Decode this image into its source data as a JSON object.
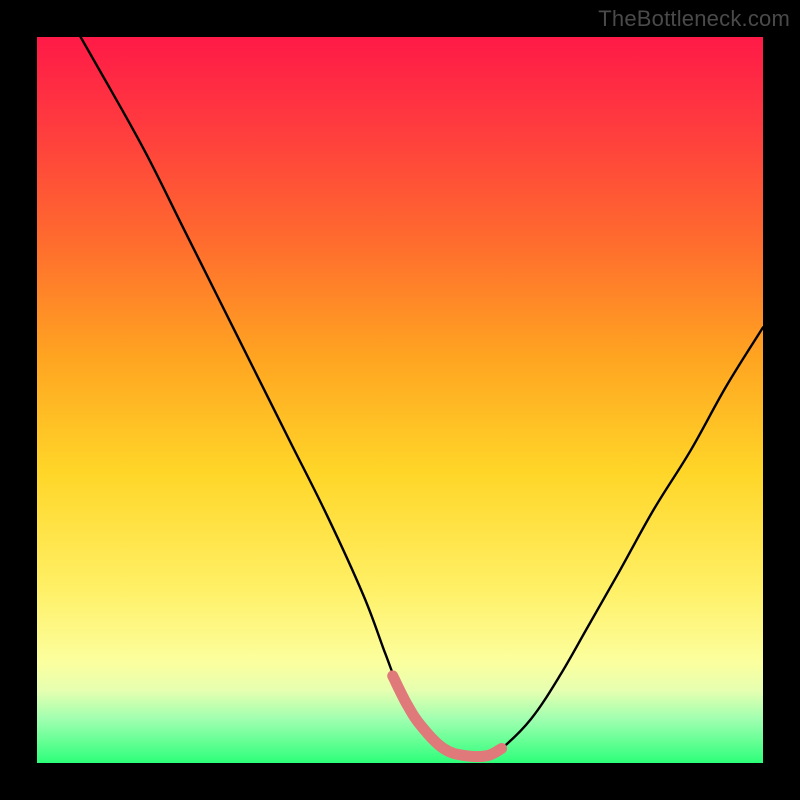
{
  "watermark": "TheBottleneck.com",
  "chart_data": {
    "type": "line",
    "title": "",
    "xlabel": "",
    "ylabel": "",
    "xlim": [
      0,
      100
    ],
    "ylim": [
      0,
      100
    ],
    "grid": false,
    "legend": false,
    "gradient_stops": [
      {
        "pos": 0,
        "color": "#ff1a47"
      },
      {
        "pos": 12,
        "color": "#ff3a3f"
      },
      {
        "pos": 28,
        "color": "#ff6b2e"
      },
      {
        "pos": 44,
        "color": "#ffa421"
      },
      {
        "pos": 60,
        "color": "#ffd628"
      },
      {
        "pos": 76,
        "color": "#fff066"
      },
      {
        "pos": 86,
        "color": "#fcff9e"
      },
      {
        "pos": 90,
        "color": "#e6ffb0"
      },
      {
        "pos": 94,
        "color": "#9fffb0"
      },
      {
        "pos": 100,
        "color": "#2dff7a"
      }
    ],
    "series": [
      {
        "name": "bottleneck-curve",
        "color": "#000000",
        "x": [
          6,
          10,
          15,
          20,
          25,
          30,
          35,
          40,
          45,
          48,
          50,
          53,
          56,
          59,
          62,
          64,
          68,
          72,
          76,
          80,
          85,
          90,
          95,
          100
        ],
        "y": [
          100,
          93,
          84,
          74,
          64,
          54,
          44,
          34,
          23,
          15,
          10,
          5,
          2,
          1,
          1,
          2,
          6,
          12,
          19,
          26,
          35,
          43,
          52,
          60
        ]
      },
      {
        "name": "highlight-segment",
        "color": "#e07a7a",
        "x": [
          49,
          51,
          53,
          56,
          59,
          62,
          64
        ],
        "y": [
          12,
          8,
          5,
          2,
          1,
          1,
          2
        ]
      }
    ],
    "annotations": []
  }
}
